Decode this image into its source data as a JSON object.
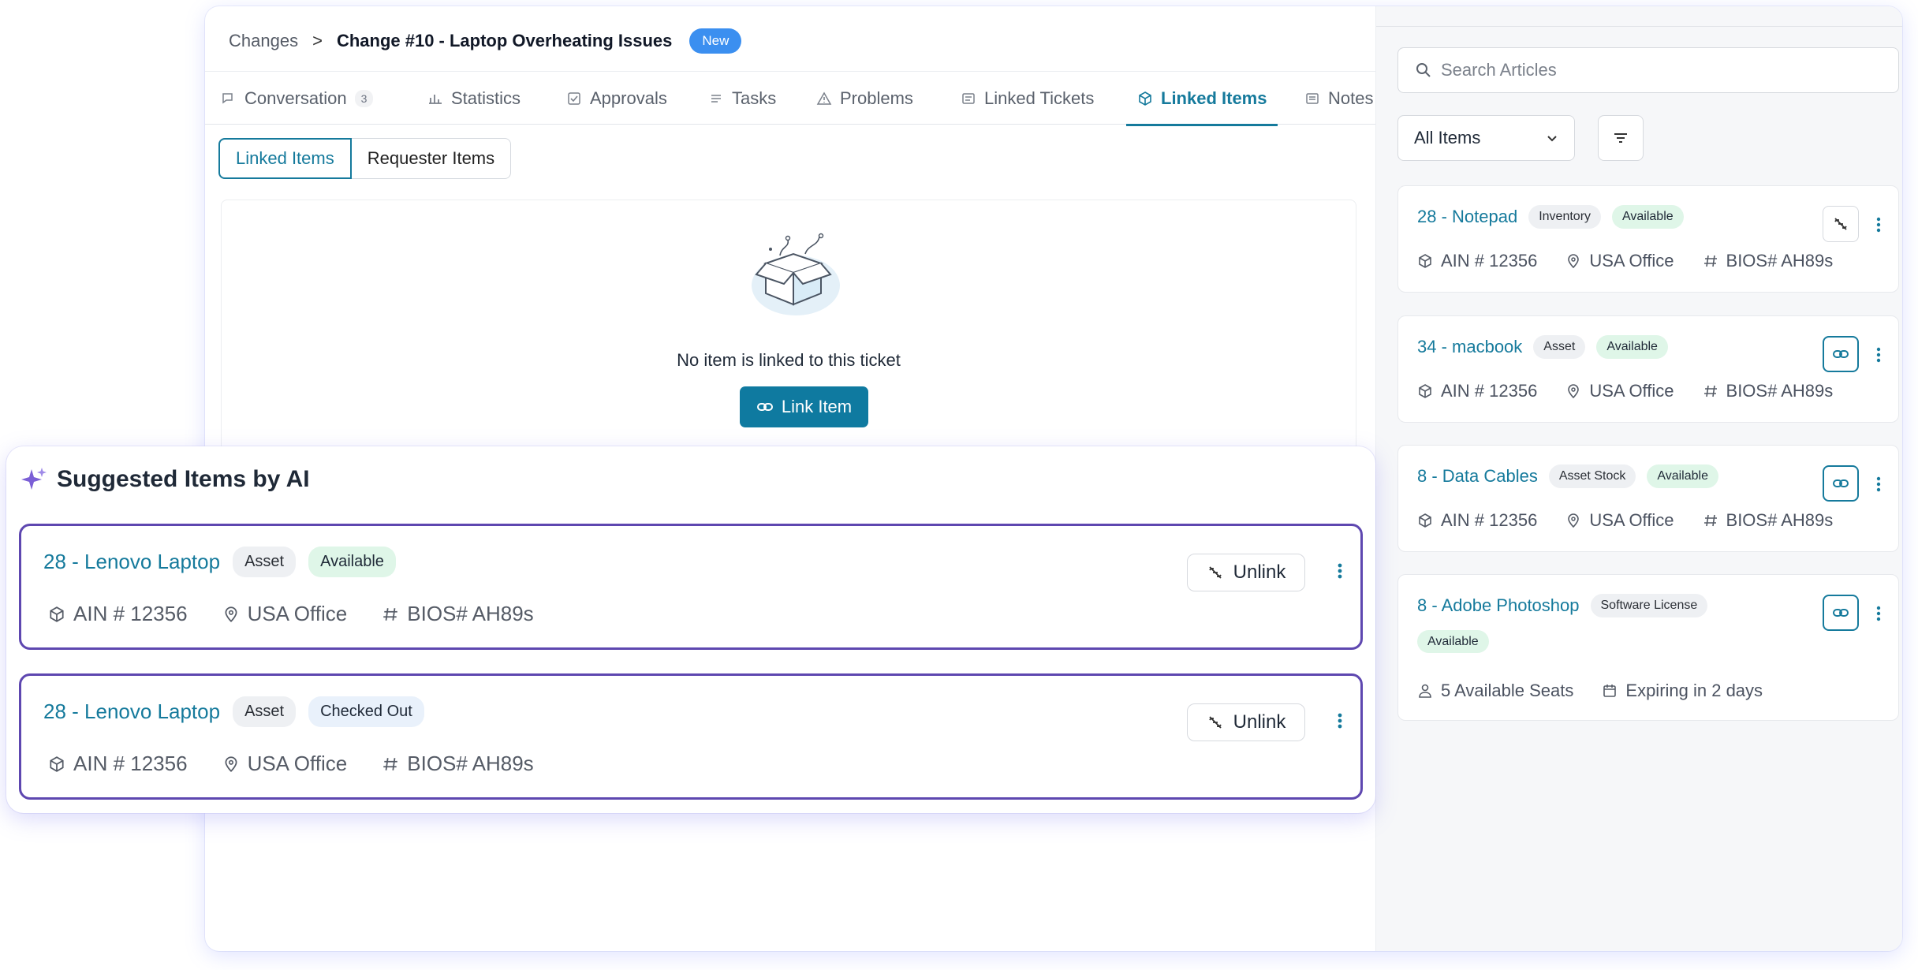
{
  "breadcrumb": {
    "parent": "Changes",
    "separator": ">",
    "title": "Change #10 - Laptop Overheating Issues",
    "badge": "New"
  },
  "tabs": [
    {
      "label": "Conversation",
      "count": "3",
      "icon": "chat-icon"
    },
    {
      "label": "Statistics",
      "icon": "bar-chart-icon"
    },
    {
      "label": "Approvals",
      "icon": "check-square-icon"
    },
    {
      "label": "Tasks",
      "icon": "list-icon"
    },
    {
      "label": "Problems",
      "icon": "warning-icon"
    },
    {
      "label": "Linked Tickets",
      "icon": "ticket-icon"
    },
    {
      "label": "Linked Items",
      "icon": "box-icon",
      "active": true
    },
    {
      "label": "Notes",
      "icon": "note-icon"
    }
  ],
  "segment": {
    "linked": "Linked Items",
    "requester": "Requester Items"
  },
  "empty_state": {
    "message": "No item is linked to this ticket",
    "button": "Link Item"
  },
  "right_panel": {
    "search_placeholder": "Search Articles",
    "filter_value": "All Items",
    "items": [
      {
        "title": "28 - Notepad",
        "type": "Inventory",
        "status": "Available",
        "ain": "AIN # 12356",
        "location": "USA Office",
        "bios": "BIOS# AH89s",
        "linked": true
      },
      {
        "title": "34 - macbook",
        "type": "Asset",
        "status": "Available",
        "ain": "AIN # 12356",
        "location": "USA Office",
        "bios": "BIOS# AH89s",
        "linked": false
      },
      {
        "title": "8 - Data Cables",
        "type": "Asset Stock",
        "status": "Available",
        "ain": "AIN # 12356",
        "location": "USA Office",
        "bios": "BIOS# AH89s",
        "linked": false
      },
      {
        "title": "8 - Adobe Photoshop",
        "type": "Software License",
        "status": "Available",
        "seats": "5 Available Seats",
        "expiry": "Expiring in 2 days",
        "linked": false
      }
    ]
  },
  "suggested": {
    "title": "Suggested Items by AI",
    "items": [
      {
        "title": "28 - Lenovo Laptop",
        "type": "Asset",
        "status": "Available",
        "ain": "AIN # 12356",
        "location": "USA Office",
        "bios": "BIOS# AH89s",
        "action": "Unlink"
      },
      {
        "title": "28 - Lenovo Laptop",
        "type": "Asset",
        "status": "Checked Out",
        "ain": "AIN # 12356",
        "location": "USA Office",
        "bios": "BIOS# AH89s",
        "action": "Unlink"
      }
    ]
  },
  "colors": {
    "accent": "#157a9c",
    "badge_new": "#3b8ff0",
    "ai_border": "#5e47b0",
    "available_bg": "#dff6e8",
    "checked_out_bg": "#e9f1fb"
  }
}
